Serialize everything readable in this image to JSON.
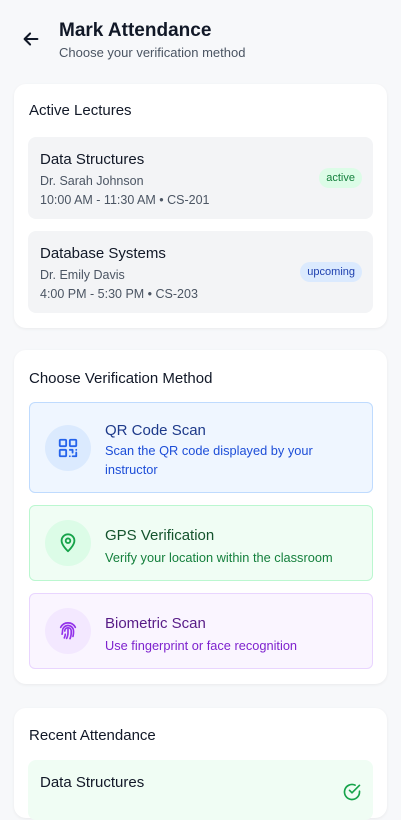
{
  "header": {
    "title": "Mark Attendance",
    "subtitle": "Choose your verification method",
    "back_icon": "arrow-left-icon"
  },
  "active_lectures": {
    "title": "Active Lectures",
    "items": [
      {
        "name": "Data Structures",
        "instructor": "Dr. Sarah Johnson",
        "time": "10:00 AM - 11:30 AM • CS-201",
        "status": "active"
      },
      {
        "name": "Database Systems",
        "instructor": "Dr. Emily Davis",
        "time": "4:00 PM - 5:30 PM • CS-203",
        "status": "upcoming"
      }
    ]
  },
  "verification": {
    "title": "Choose Verification Method",
    "methods": [
      {
        "title": "QR Code Scan",
        "description": "Scan the QR code displayed by your instructor",
        "icon": "qr-code-icon",
        "color": "#2563eb"
      },
      {
        "title": "GPS Verification",
        "description": "Verify your location within the classroom",
        "icon": "map-pin-icon",
        "color": "#16a34a"
      },
      {
        "title": "Biometric Scan",
        "description": "Use fingerprint or face recognition",
        "icon": "fingerprint-icon",
        "color": "#9333ea"
      }
    ]
  },
  "recent": {
    "title": "Recent Attendance",
    "items": [
      {
        "name": "Data Structures",
        "icon": "check-circle-icon"
      }
    ]
  }
}
